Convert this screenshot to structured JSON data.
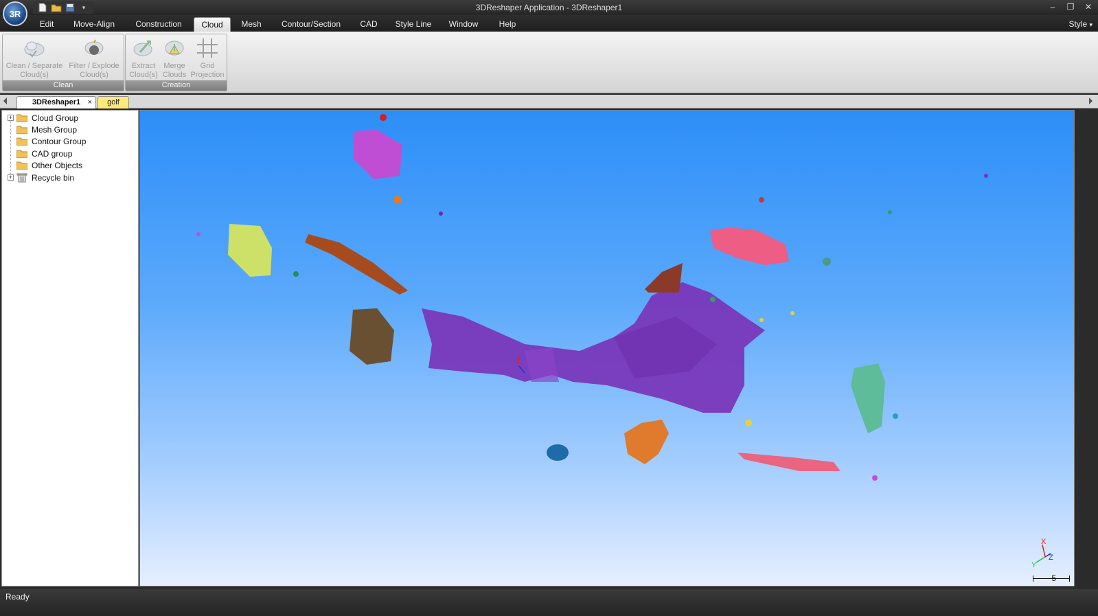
{
  "window": {
    "title": "3DReshaper Application - 3DReshaper1",
    "orb_label": "3R"
  },
  "menu": {
    "tabs": [
      "Edit",
      "Move-Align",
      "Construction",
      "Cloud",
      "Mesh",
      "Contour/Section",
      "CAD",
      "Style Line",
      "Window",
      "Help"
    ],
    "active": "Cloud",
    "style_label": "Style"
  },
  "ribbon": {
    "groups": [
      {
        "label": "Clean",
        "buttons": [
          {
            "line1": "Clean / Separate",
            "line2": "Cloud(s)",
            "icon": "cloud-clean-icon"
          },
          {
            "line1": "Filter / Explode",
            "line2": "Cloud(s)",
            "icon": "filter-explode-icon"
          }
        ]
      },
      {
        "label": "Creation",
        "buttons": [
          {
            "line1": "Extract",
            "line2": "Cloud(s)",
            "icon": "extract-cloud-icon"
          },
          {
            "line1": "Merge",
            "line2": "Clouds",
            "icon": "merge-clouds-icon"
          },
          {
            "line1": "Grid",
            "line2": "Projection",
            "icon": "grid-projection-icon"
          }
        ]
      }
    ]
  },
  "documents": {
    "tabs": [
      {
        "label": "3DReshaper1",
        "close": "×"
      },
      {
        "label": "golf"
      }
    ]
  },
  "tree": {
    "items": [
      {
        "label": "Cloud Group",
        "expandable": true
      },
      {
        "label": "Mesh Group",
        "expandable": false
      },
      {
        "label": "Contour Group",
        "expandable": false
      },
      {
        "label": "CAD group",
        "expandable": false
      },
      {
        "label": "Other Objects",
        "expandable": false
      },
      {
        "label": "Recycle bin",
        "expandable": true
      }
    ]
  },
  "viewport": {
    "scale_value": "5",
    "axis_labels": {
      "x": "X",
      "y": "Y",
      "z": "Z"
    },
    "colors": {
      "sky_top": "#2c8ef8",
      "sky_bottom": "#e6efff",
      "main_cloud": "#7a34b8"
    }
  },
  "status": {
    "text": "Ready"
  }
}
